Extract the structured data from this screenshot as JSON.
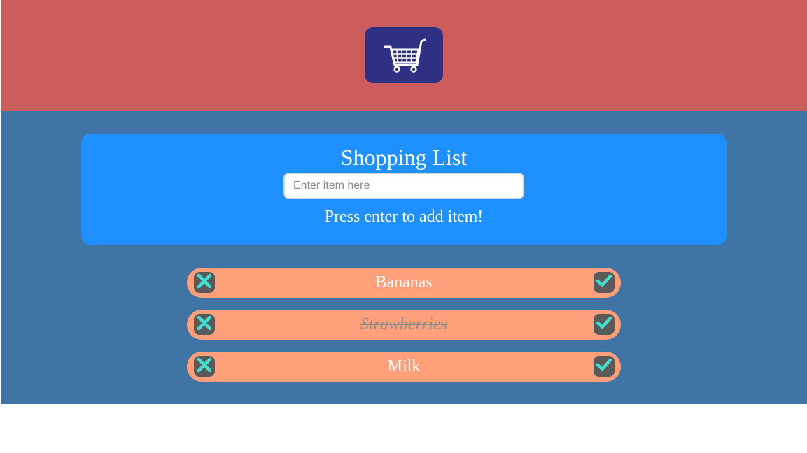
{
  "app": {
    "logo_icon": "shopping-cart-icon",
    "colors": {
      "header_bg": "#cd5c5c",
      "logo_bg": "#2e3183",
      "main_bg": "#3f74a4",
      "card_bg": "#1e90ff",
      "item_bg": "#ffa07a",
      "icon_accent": "#40e0d0"
    }
  },
  "card": {
    "title": "Shopping List",
    "input_value": "",
    "input_placeholder": "Enter item here",
    "hint": "Press enter to add item!"
  },
  "items": [
    {
      "label": "Bananas",
      "completed": false,
      "delete_icon": "x-icon",
      "done_icon": "check-icon"
    },
    {
      "label": "Strawberries",
      "completed": true,
      "delete_icon": "x-icon",
      "done_icon": "check-icon"
    },
    {
      "label": "Milk",
      "completed": false,
      "delete_icon": "x-icon",
      "done_icon": "check-icon"
    }
  ]
}
